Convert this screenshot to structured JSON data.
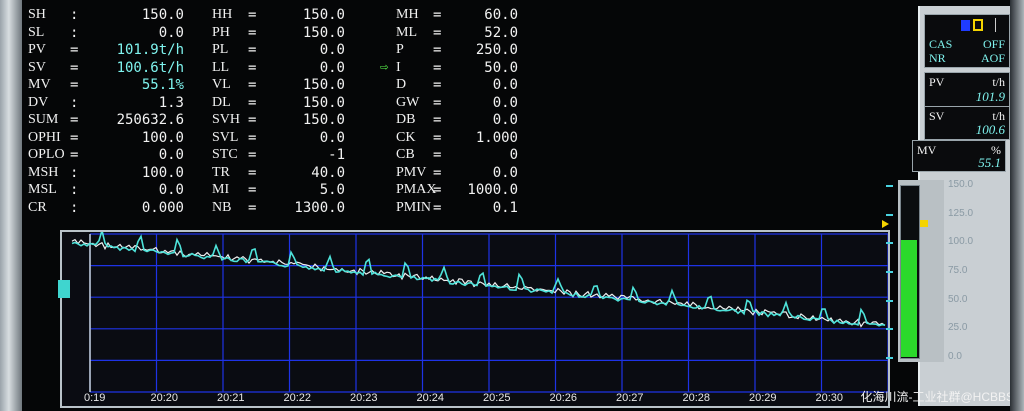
{
  "params": {
    "col1": [
      {
        "name": "SH",
        "value": "150.0"
      },
      {
        "name": "SL",
        "value": "0.0"
      },
      {
        "name": "PV",
        "value": "101.9t/h"
      },
      {
        "name": "SV",
        "value": "100.6t/h"
      },
      {
        "name": "MV",
        "value": "55.1%"
      },
      {
        "name": "DV",
        "value": "1.3"
      },
      {
        "name": "SUM",
        "value": "250632.6"
      },
      {
        "name": "OPHI",
        "value": "100.0"
      },
      {
        "name": "OPLO",
        "value": "0.0"
      },
      {
        "name": "MSH",
        "value": "100.0"
      },
      {
        "name": "MSL",
        "value": "0.0"
      },
      {
        "name": "CR",
        "value": "0.000"
      }
    ],
    "col2": [
      {
        "name": "HH",
        "value": "150.0"
      },
      {
        "name": "PH",
        "value": "150.0"
      },
      {
        "name": "PL",
        "value": "0.0"
      },
      {
        "name": "LL",
        "value": "0.0"
      },
      {
        "name": "VL",
        "value": "150.0"
      },
      {
        "name": "DL",
        "value": "150.0"
      },
      {
        "name": "SVH",
        "value": "150.0"
      },
      {
        "name": "SVL",
        "value": "0.0"
      },
      {
        "name": "STC",
        "value": "-1"
      },
      {
        "name": "TR",
        "value": "40.0"
      },
      {
        "name": "MI",
        "value": "5.0"
      },
      {
        "name": "NB",
        "value": "1300.0"
      }
    ],
    "col3": [
      {
        "name": "MH",
        "value": "60.0"
      },
      {
        "name": "ML",
        "value": "52.0"
      },
      {
        "name": "P",
        "value": "250.0"
      },
      {
        "name": "I",
        "value": "50.0"
      },
      {
        "name": "D",
        "value": "0.0"
      },
      {
        "name": "GW",
        "value": "0.0"
      },
      {
        "name": "DB",
        "value": "0.0"
      },
      {
        "name": "CK",
        "value": "1.000"
      },
      {
        "name": "CB",
        "value": "0"
      },
      {
        "name": "PMV",
        "value": "0.0"
      },
      {
        "name": "PMAX",
        "value": "1000.0"
      },
      {
        "name": "PMIN",
        "value": "0.1"
      }
    ]
  },
  "faceplate": {
    "cas": "CAS",
    "cas_state": "OFF",
    "nr": "NR",
    "nr_state": "AOF",
    "pv_label": "PV",
    "pv_unit": "t/h",
    "pv_value": "101.9",
    "sv_label": "SV",
    "sv_unit": "t/h",
    "sv_value": "100.6",
    "mv_label": "MV",
    "mv_unit": "%",
    "mv_value": "55.1",
    "scale": [
      "150.0",
      "125.0",
      "100.0",
      "75.0",
      "50.0",
      "25.0",
      "0.0"
    ],
    "bar_level": 0.68,
    "colors": {
      "pv": "#7ff3ee",
      "bar": "#2bd92b",
      "marker": "#f5d400"
    }
  },
  "trend": {
    "time_ticks": [
      "0:19",
      "20:20",
      "20:21",
      "20:22",
      "20:23",
      "20:24",
      "20:25",
      "20:26",
      "20:27",
      "20:28",
      "20:29",
      "20:30"
    ],
    "colors": {
      "pv": "#4ee3da",
      "sv": "#f0f0f0",
      "grid": "#1e33e6"
    }
  },
  "watermark": "化海川流-工业社群@HCBBS"
}
